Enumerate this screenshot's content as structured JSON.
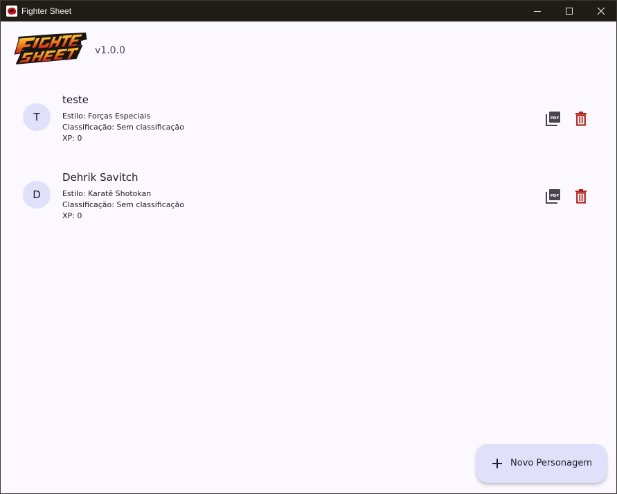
{
  "window": {
    "title": "Fighter Sheet"
  },
  "header": {
    "version": "v1.0.0",
    "logo_text": "FIGHTER SHEET"
  },
  "characters": [
    {
      "initial": "T",
      "name": "teste",
      "style": "Estilo: Forças Especiais",
      "classification": "Classificação: Sem classificação",
      "xp": "XP: 0"
    },
    {
      "initial": "D",
      "name": "Dehrik Savitch",
      "style": "Estilo: Karatê Shotokan",
      "classification": "Classificação: Sem classificação",
      "xp": "XP: 0"
    }
  ],
  "icons": {
    "pdf": "pdf-icon",
    "delete": "trash-icon",
    "add": "plus-icon"
  },
  "fab": {
    "label": "Novo Personagem"
  },
  "colors": {
    "titlebar": "#201d17",
    "background": "#fcf8ff",
    "avatar": "#e0e0fa",
    "delete": "#b3261e",
    "pdf": "#49454f",
    "fab": "#e0e0fa"
  }
}
